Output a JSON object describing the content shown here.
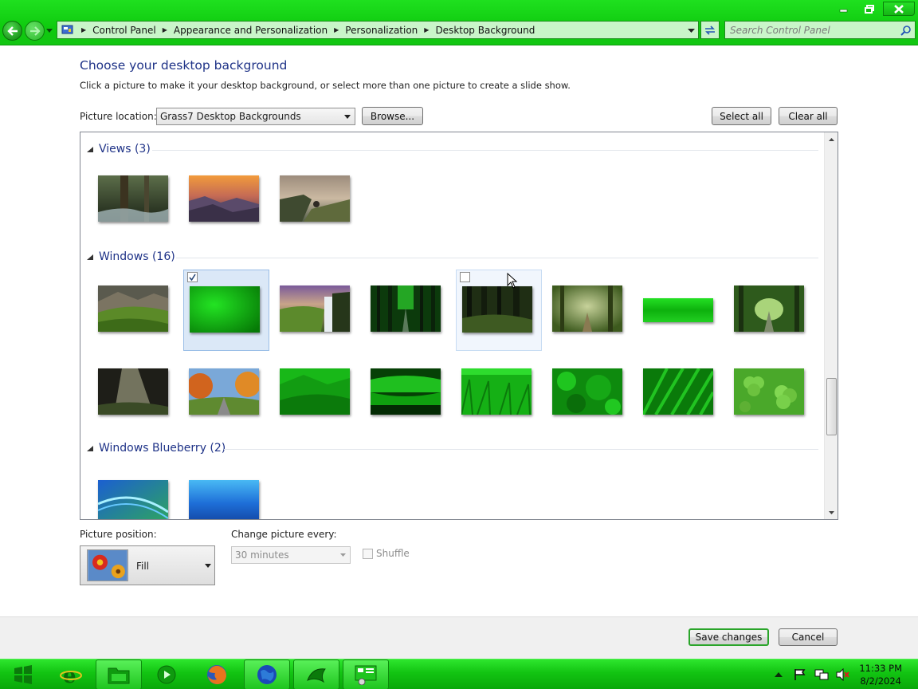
{
  "window": {
    "caption_buttons": [
      "minimize",
      "restore",
      "close"
    ]
  },
  "address_bar": {
    "breadcrumbs": [
      "Control Panel",
      "Appearance and Personalization",
      "Personalization",
      "Desktop Background"
    ]
  },
  "search": {
    "placeholder": "Search Control Panel"
  },
  "content": {
    "heading": "Choose your desktop background",
    "subheading": "Click a picture to make it your desktop background, or select more than one picture to create a slide show.",
    "picture_location_label": "Picture location:",
    "picture_location_value": "Grass7 Desktop Backgrounds",
    "browse_label": "Browse...",
    "select_all_label": "Select all",
    "clear_all_label": "Clear all"
  },
  "gallery": {
    "groups": [
      {
        "title": "Views (3)",
        "tiles": [
          "forest-stream",
          "sunset-hills",
          "coastal-cliffs"
        ]
      },
      {
        "title": "Windows (16)",
        "tiles": [
          "mountain-valley",
          "green-gradient",
          "waterfall",
          "forest-path",
          "dark-forest",
          "misty-forest",
          "green-bar",
          "tree-tunnel",
          "sunbeam-forest",
          "autumn-road",
          "green-hills",
          "green-lake",
          "grass-field",
          "green-leaves",
          "grass-blades",
          "clovers"
        ]
      },
      {
        "title": "Windows Blueberry (2)",
        "tiles": [
          "blue-waves",
          "blue-gradient"
        ]
      }
    ],
    "selected_tile": "green-gradient",
    "hovered_tile": "dark-forest"
  },
  "options": {
    "position_label": "Picture position:",
    "position_value": "Fill",
    "change_every_label": "Change picture every:",
    "change_every_value": "30 minutes",
    "shuffle_label": "Shuffle",
    "shuffle_checked": false
  },
  "footer": {
    "save_label": "Save changes",
    "cancel_label": "Cancel"
  },
  "taskbar": {
    "items": [
      "start-button",
      "internet-explorer",
      "file-explorer",
      "media-player",
      "firefox",
      "globe",
      "windows-flag",
      "control-panel"
    ],
    "time": "11:33 PM",
    "date": "8/2/2024"
  },
  "colors": {
    "accent_green": "#12c412",
    "heading_blue": "#1e3287",
    "selection_blue": "#dbe8f7"
  }
}
